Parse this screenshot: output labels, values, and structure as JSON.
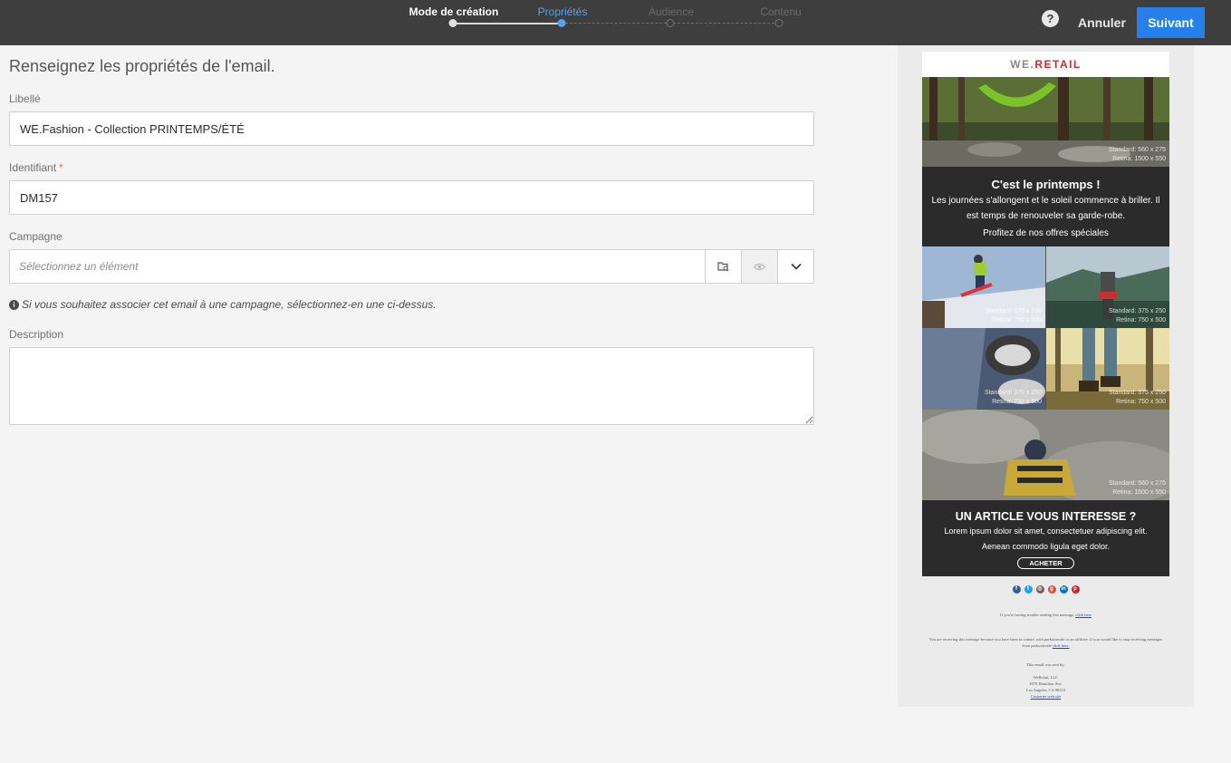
{
  "wizard": {
    "steps": [
      {
        "label": "Mode de création",
        "state": "done"
      },
      {
        "label": "Propriétés",
        "state": "active"
      },
      {
        "label": "Audience",
        "state": "pending"
      },
      {
        "label": "Contenu",
        "state": "pending"
      }
    ]
  },
  "toolbar": {
    "help_icon": "question-mark-icon",
    "help_glyph": "?",
    "cancel_label": "Annuler",
    "next_label": "Suivant"
  },
  "form": {
    "title": "Renseignez les propriétés de l'email.",
    "label_field": {
      "label": "Libellé",
      "value": "WE.Fashion - Collection PRINTEMPS/ÉTÉ"
    },
    "id_field": {
      "label": "Identifiant",
      "required_mark": "*",
      "value": "DM157"
    },
    "campaign_field": {
      "label": "Campagne",
      "placeholder": "Sélectionnez un élément"
    },
    "campaign_hint": "Si vous souhaitez associer cet email à une campagne, sélectionnez-en une ci-dessus.",
    "hint_icon_glyph": "i",
    "description_field": {
      "label": "Description",
      "value": ""
    }
  },
  "preview": {
    "brand_prefix": "WE.",
    "brand_suffix": "RETAIL",
    "hero_meta_1": "Standard: 560 x 275",
    "hero_meta_2": "Retina: 1500 x 550",
    "spring_title": "C'est le printemps !",
    "spring_text": "Les journées s'allongent et le soleil commence à briller. Il est temps de renouveler sa garde-robe.",
    "spring_offer": "Profitez de nos offres spéciales",
    "grid_meta": [
      {
        "l1": "Standard: 375 x 250",
        "l2": "Retina: 750 x 500"
      },
      {
        "l1": "Standard: 375 x 250",
        "l2": "Retina: 750 x 500"
      },
      {
        "l1": "Standard: 375 x 250",
        "l2": "Retina: 750 x 500"
      },
      {
        "l1": "Standard: 375 x 250",
        "l2": "Retina: 750 x 500"
      }
    ],
    "wide_meta_1": "Standard: 560 x 275",
    "wide_meta_2": "Retina: 1500 x 550",
    "article_title": "UN ARTICLE VOUS INTERESSE ?",
    "article_text_1": "Lorem ipsum dolor sit amet, consectetuer adipiscing elit.",
    "article_text_2": "Aenean commodo ligula eget dolor.",
    "buy_label": "ACHETER",
    "socials": [
      {
        "icon": "facebook-icon",
        "glyph": "f",
        "color": "#3b5998"
      },
      {
        "icon": "twitter-icon",
        "glyph": "t",
        "color": "#1da1f2"
      },
      {
        "icon": "instagram-icon",
        "glyph": "◎",
        "color": "#7d5a4f"
      },
      {
        "icon": "google-plus-icon",
        "glyph": "g",
        "color": "#dd4b39"
      },
      {
        "icon": "linkedin-icon",
        "glyph": "in",
        "color": "#0077b5"
      },
      {
        "icon": "pinterest-icon",
        "glyph": "p",
        "color": "#cb2027"
      }
    ],
    "footer_trouble": "If you're having trouble reading this message,",
    "footer_trouble_link": "click here",
    "footer_optout": "You are receiving this message because you have been in contact with parkssinvale or an affiliate. If you would like to stop receiving messages from parkssinvale",
    "footer_optout_link": "click here.",
    "footer_sent_by": "This email was sent by:",
    "footer_company": "WeRetail, LLC",
    "footer_address": "4978 Hamilton Ave.",
    "footer_city": "Los Angeles, CA 90210",
    "footer_site_link": "Customer web site"
  }
}
